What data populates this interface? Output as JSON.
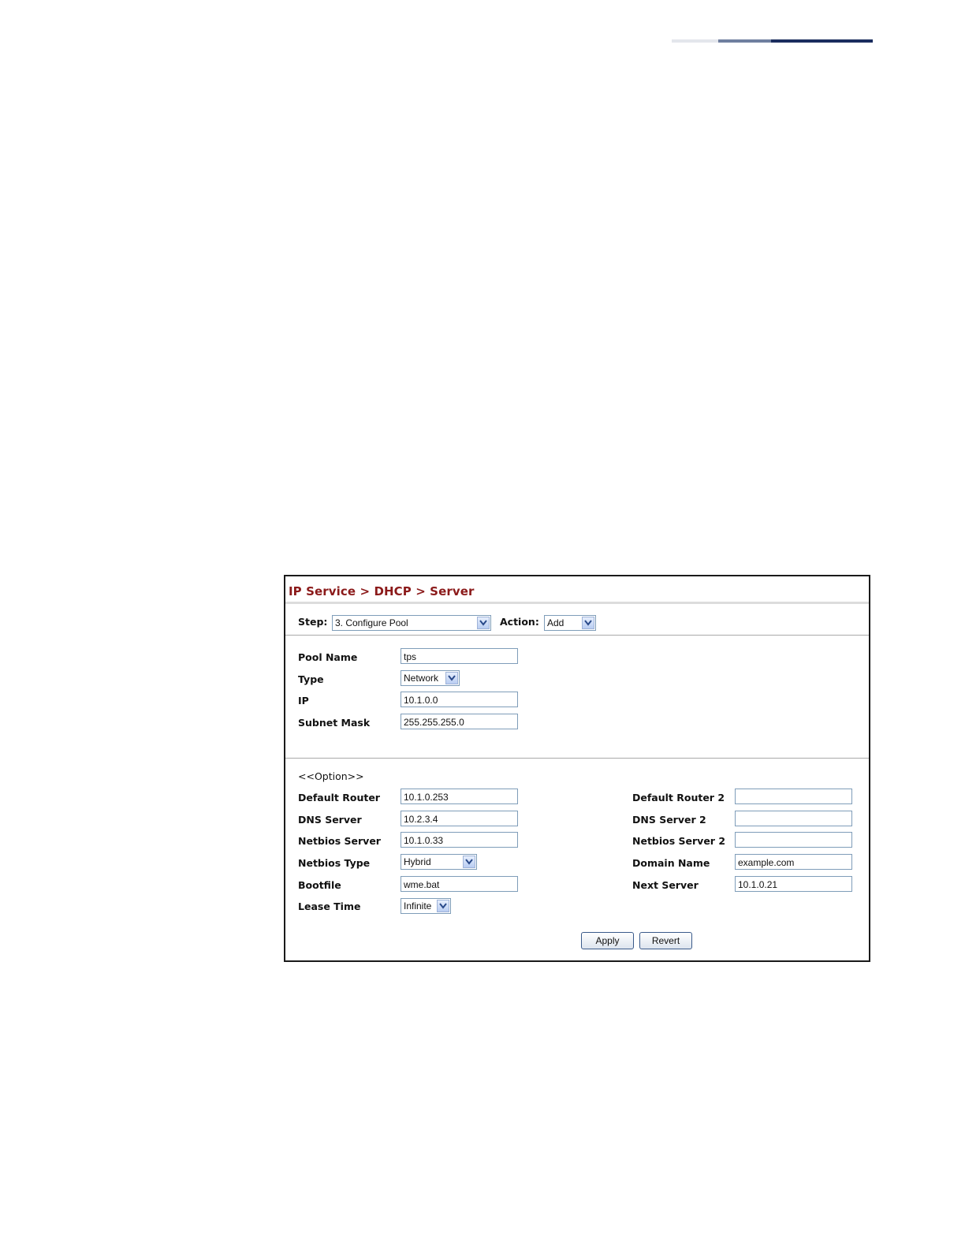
{
  "breadcrumb": "IP Service > DHCP > Server",
  "step": {
    "label": "Step:",
    "value": "3. Configure Pool"
  },
  "action": {
    "label": "Action:",
    "value": "Add"
  },
  "pool": {
    "pool_name": {
      "label": "Pool Name",
      "value": "tps"
    },
    "type": {
      "label": "Type",
      "value": "Network"
    },
    "ip": {
      "label": "IP",
      "value": "10.1.0.0"
    },
    "subnet_mask": {
      "label": "Subnet Mask",
      "value": "255.255.255.0"
    }
  },
  "option_header": "<<Option>>",
  "options": {
    "default_router": {
      "label": "Default Router",
      "value": "10.1.0.253"
    },
    "dns_server": {
      "label": "DNS Server",
      "value": "10.2.3.4"
    },
    "netbios_server": {
      "label": "Netbios Server",
      "value": "10.1.0.33"
    },
    "netbios_type": {
      "label": "Netbios Type",
      "value": "Hybrid"
    },
    "bootfile": {
      "label": "Bootfile",
      "value": "wme.bat"
    },
    "lease_time": {
      "label": "Lease Time",
      "value": "Infinite"
    },
    "default_router_2": {
      "label": "Default Router 2",
      "value": ""
    },
    "dns_server_2": {
      "label": "DNS Server 2",
      "value": ""
    },
    "netbios_server_2": {
      "label": "Netbios Server 2",
      "value": ""
    },
    "domain_name": {
      "label": "Domain Name",
      "value": "example.com"
    },
    "next_server": {
      "label": "Next Server",
      "value": "10.1.0.21"
    }
  },
  "buttons": {
    "apply": "Apply",
    "revert": "Revert"
  },
  "colors": {
    "title": "#8b1a1a",
    "field_border": "#7f9db9",
    "accent_bar": "#1b2d5e"
  }
}
